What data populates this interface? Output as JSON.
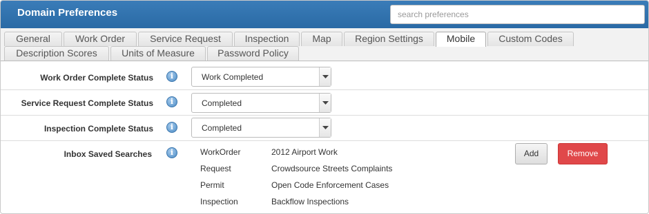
{
  "header": {
    "title": "Domain Preferences"
  },
  "search": {
    "placeholder": "search preferences"
  },
  "tabs": [
    {
      "label": "General"
    },
    {
      "label": "Work Order"
    },
    {
      "label": "Service Request"
    },
    {
      "label": "Inspection"
    },
    {
      "label": "Map"
    },
    {
      "label": "Region Settings"
    },
    {
      "label": "Mobile",
      "active": true
    },
    {
      "label": "Custom Codes"
    },
    {
      "label": "Description Scores"
    },
    {
      "label": "Units of Measure"
    },
    {
      "label": "Password Policy"
    }
  ],
  "settings": {
    "work_order_status": {
      "label": "Work Order Complete Status",
      "value": "Work Completed"
    },
    "service_request_status": {
      "label": "Service Request Complete Status",
      "value": "Completed"
    },
    "inspection_status": {
      "label": "Inspection Complete Status",
      "value": "Completed"
    },
    "inbox": {
      "label": "Inbox Saved Searches",
      "items": [
        {
          "type": "WorkOrder",
          "name": "2012 Airport Work"
        },
        {
          "type": "Request",
          "name": "Crowdsource Streets Complaints"
        },
        {
          "type": "Permit",
          "name": "Open Code Enforcement Cases"
        },
        {
          "type": "Inspection",
          "name": "Backflow Inspections"
        }
      ],
      "add_label": "Add",
      "remove_label": "Remove"
    }
  },
  "info_icon": "info-icon",
  "colors": {
    "header": "#2e6da4",
    "remove": "#e0484a"
  }
}
